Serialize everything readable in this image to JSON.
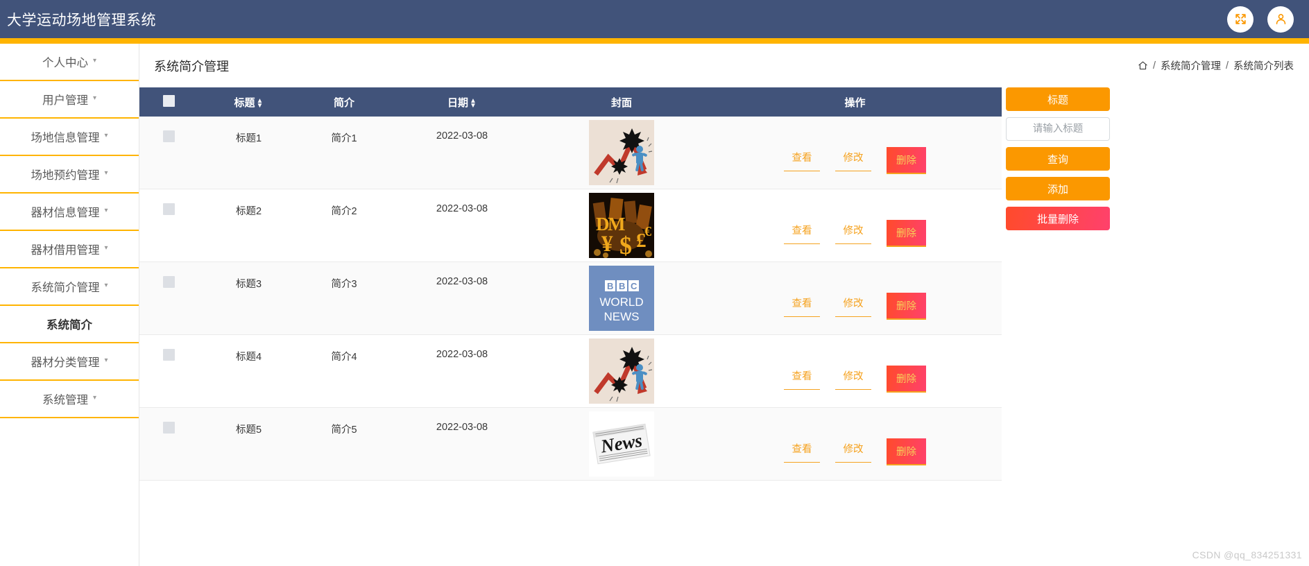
{
  "header": {
    "app_title": "大学运动场地管理系统",
    "fullscreen_icon": "fullscreen-expand-icon",
    "user_icon": "user-account-icon",
    "bg_color": "#41537a",
    "accent_color": "#ffb400"
  },
  "sidebar": {
    "items": [
      {
        "label": "个人中心",
        "has_caret": true,
        "active": false
      },
      {
        "label": "用户管理",
        "has_caret": true,
        "active": false
      },
      {
        "label": "场地信息管理",
        "has_caret": true,
        "active": false
      },
      {
        "label": "场地预约管理",
        "has_caret": true,
        "active": false
      },
      {
        "label": "器材信息管理",
        "has_caret": true,
        "active": false
      },
      {
        "label": "器材借用管理",
        "has_caret": true,
        "active": false
      },
      {
        "label": "系统简介管理",
        "has_caret": true,
        "active": false
      },
      {
        "label": "系统简介",
        "has_caret": false,
        "active": true
      },
      {
        "label": "器材分类管理",
        "has_caret": true,
        "active": false
      },
      {
        "label": "系统管理",
        "has_caret": true,
        "active": false
      }
    ],
    "caret_glyph": "▾"
  },
  "page": {
    "title": "系统简介管理",
    "breadcrumb": {
      "home_icon": "home-icon",
      "separator": "/",
      "crumbs": [
        "系统简介管理",
        "系统简介列表"
      ]
    }
  },
  "table": {
    "columns": [
      {
        "key": "check",
        "label": "",
        "sortable": false
      },
      {
        "key": "title",
        "label": "标题",
        "sortable": true
      },
      {
        "key": "intro",
        "label": "简介",
        "sortable": false
      },
      {
        "key": "date",
        "label": "日期",
        "sortable": true
      },
      {
        "key": "cover",
        "label": "封面",
        "sortable": false
      },
      {
        "key": "ops",
        "label": "操作",
        "sortable": false
      }
    ],
    "sort_glyph_up": "▲",
    "sort_glyph_down": "▼",
    "rows": [
      {
        "title": "标题1",
        "intro": "简介1",
        "date": "2022-03-08",
        "cover": "stock-market-crash-chart-image"
      },
      {
        "title": "标题2",
        "intro": "简介2",
        "date": "2022-03-08",
        "cover": "gold-currency-symbols-image"
      },
      {
        "title": "标题3",
        "intro": "简介3",
        "date": "2022-03-08",
        "cover": "bbc-world-news-logo-image"
      },
      {
        "title": "标题4",
        "intro": "简介4",
        "date": "2022-03-08",
        "cover": "stock-market-crash-chart-image"
      },
      {
        "title": "标题5",
        "intro": "简介5",
        "date": "2022-03-08",
        "cover": "newspaper-news-image"
      }
    ],
    "row_actions": {
      "view": "查看",
      "edit": "修改",
      "delete": "删除"
    },
    "header_bg": "#41537a"
  },
  "right_panel": {
    "title_button": "标题",
    "search_placeholder": "请输入标题",
    "search_value": "",
    "query_button": "查询",
    "add_button": "添加",
    "batch_delete_button": "批量删除",
    "primary_color": "#fb9800",
    "danger_color": "#ff4b2b"
  },
  "watermark": "CSDN @qq_834251331"
}
